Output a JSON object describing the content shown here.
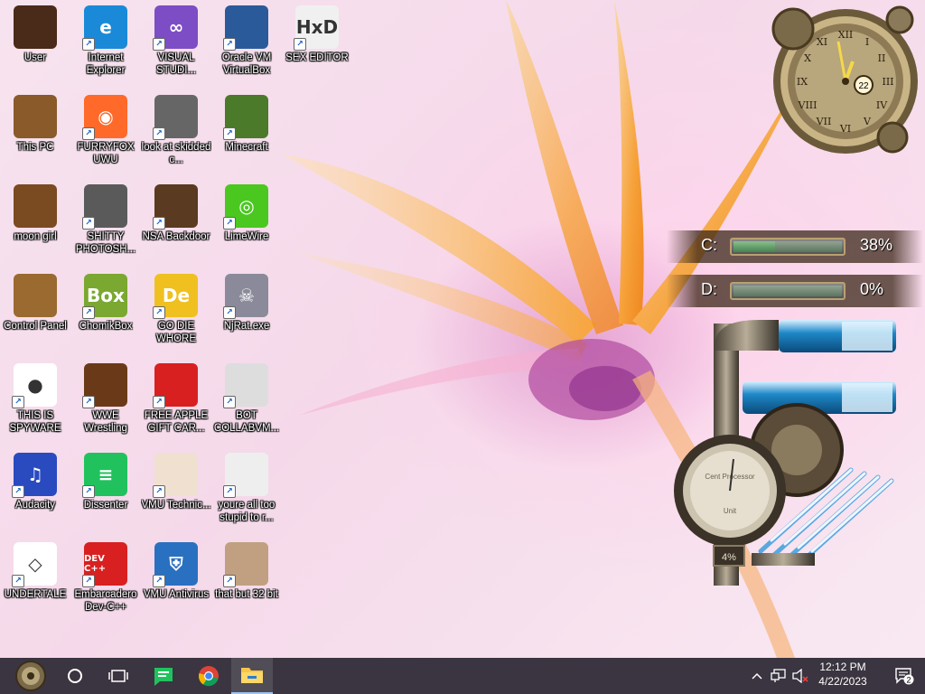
{
  "desktop": {
    "icons": [
      {
        "label": "User",
        "icon": "user-folder-icon",
        "shortcut": false
      },
      {
        "label": "Internet Explorer",
        "icon": "edge-browser-icon",
        "shortcut": true
      },
      {
        "label": "VISUAL STUDI...",
        "icon": "visual-studio-icon",
        "shortcut": true
      },
      {
        "label": "Oracle VM VirtualBox",
        "icon": "virtualbox-icon",
        "shortcut": true
      },
      {
        "label": "SEX EDITOR",
        "icon": "hex-editor-icon",
        "shortcut": true
      },
      {
        "label": "This PC",
        "icon": "this-pc-icon",
        "shortcut": false
      },
      {
        "label": "FURRYFOX UWU",
        "icon": "firefox-icon",
        "shortcut": true
      },
      {
        "label": "look at skidded c...",
        "icon": "windows-stack-icon",
        "shortcut": true
      },
      {
        "label": "Minecraft",
        "icon": "minecraft-icon",
        "shortcut": true
      },
      {
        "label": "moon girl",
        "icon": "moon-girl-icon",
        "shortcut": false
      },
      {
        "label": "SHITTY PHOTOSH...",
        "icon": "gimp-icon",
        "shortcut": true
      },
      {
        "label": "NSA Backdoor",
        "icon": "nsa-backdoor-icon",
        "shortcut": true
      },
      {
        "label": "LimeWire",
        "icon": "limewire-icon",
        "shortcut": true
      },
      {
        "label": "Control Panel",
        "icon": "control-panel-icon",
        "shortcut": false
      },
      {
        "label": "ChomikBox",
        "icon": "chomikbox-icon",
        "shortcut": true
      },
      {
        "label": "GO DIE WHORE",
        "icon": "de-app-icon",
        "shortcut": true
      },
      {
        "label": "NjRat.exe",
        "icon": "skull-icon",
        "shortcut": true
      },
      {
        "label": "THIS IS SPYWARE",
        "icon": "chrome-icon",
        "shortcut": true
      },
      {
        "label": "WWE Wrestling",
        "icon": "wwe-wrestling-icon",
        "shortcut": true
      },
      {
        "label": "FREE APPLE GIFT CAR...",
        "icon": "apple-icon",
        "shortcut": true
      },
      {
        "label": "BOT COLLABVM...",
        "icon": "imac-icon",
        "shortcut": true
      },
      {
        "label": "Audacity",
        "icon": "audacity-icon",
        "shortcut": true
      },
      {
        "label": "Dissenter",
        "icon": "dissenter-icon",
        "shortcut": true
      },
      {
        "label": "VMU Technic...",
        "icon": "doctor-icon",
        "shortcut": true
      },
      {
        "label": "youre all too stupid to r...",
        "icon": "portrait-icon",
        "shortcut": true
      },
      {
        "label": "UNDERTALE",
        "icon": "unity-icon",
        "shortcut": true
      },
      {
        "label": "Embarcadero Dev-C++",
        "icon": "dev-cpp-icon",
        "shortcut": true
      },
      {
        "label": "VMU Antivirus",
        "icon": "shield-icon",
        "shortcut": true
      },
      {
        "label": "that but 32 bit",
        "icon": "lady-portrait-icon",
        "shortcut": true
      }
    ]
  },
  "gadgets": {
    "clock": {
      "day": "22"
    },
    "drives": [
      {
        "letter": "C:",
        "percent": "38%",
        "fill": 0.38
      },
      {
        "letter": "D:",
        "percent": "0%",
        "fill": 0.0
      }
    ],
    "gauge": {
      "label_top": "Cent Processor",
      "label_unit": "Unit",
      "value": "4%"
    }
  },
  "taskbar": {
    "start_icon": "steampunk-start-icon",
    "search_icon": "cortana-circle-icon",
    "task_view_icon": "task-view-icon",
    "pinned": [
      {
        "name": "dissenter",
        "icon": "dissenter-icon"
      },
      {
        "name": "chrome",
        "icon": "chrome-icon"
      },
      {
        "name": "file-explorer",
        "icon": "folder-icon",
        "active": true
      }
    ],
    "tray": {
      "time": "12:12 PM",
      "date": "4/22/2023",
      "notifications": "2"
    }
  },
  "colors": {
    "taskbar_bg": "#3a3540",
    "wallpaper_pink": "#f5d9ea",
    "petal_orange": "#f6a23a"
  }
}
